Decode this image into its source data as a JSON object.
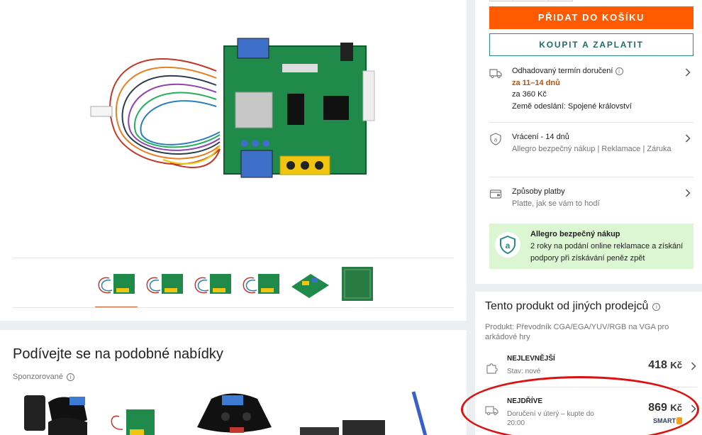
{
  "buy": {
    "add_to_cart": "PŘIDAT DO KOŠÍKU",
    "buy_now": "KOUPIT A ZAPLATIT"
  },
  "delivery": {
    "title": "Odhadovaný termín doručení",
    "date": "za 11–14 dnů",
    "price": "za 360 Kč",
    "country": "Země odeslání: Spojené království"
  },
  "returns": {
    "title": "Vrácení - 14 dnů",
    "sub": "Allegro bezpečný nákup | Reklamace | Záruka"
  },
  "payment": {
    "title": "Způsoby platby",
    "sub": "Platte, jak se vám to hodí"
  },
  "safe_purchase": {
    "title": "Allegro bezpečný nákup",
    "text": "2 roky na podání online reklamace a získání podpory při získávání peněz zpět"
  },
  "other_sellers": {
    "title": "Tento produkt od jiných prodejců",
    "product": "Produkt: Převodník CGA/EGA/YUV/RGB na VGA pro arkádové hry",
    "offers": [
      {
        "label": "NEJLEVNĚJŠÍ",
        "sub": "Stav: nové",
        "price": "418",
        "currency": "Kč"
      },
      {
        "label": "NEJDŘÍVE",
        "sub": "Doručení v úterý – kupte do 20:00",
        "price": "869",
        "currency": "Kč",
        "badge": "SMART"
      }
    ]
  },
  "similar": {
    "title": "Podívejte se na podobné nabídky",
    "sponsored": "Sponzorované"
  },
  "colors": {
    "accent": "#ff5a00",
    "teal": "#2b8a86",
    "delivery_orange": "#b5530f",
    "safe_green": "#dcf5d2",
    "annotation_red": "#dd1111"
  }
}
